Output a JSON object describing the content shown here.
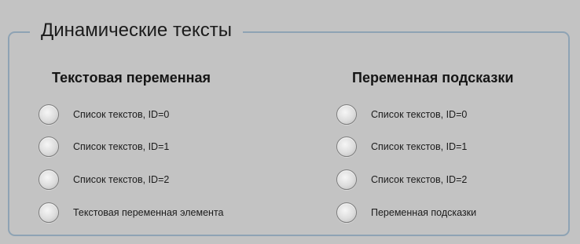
{
  "group": {
    "title": "Динамические тексты"
  },
  "left_column": {
    "header": "Текстовая переменная",
    "options": [
      {
        "label": "Список текстов, ID=0",
        "selected": false
      },
      {
        "label": "Список текстов, ID=1",
        "selected": false
      },
      {
        "label": "Список текстов, ID=2",
        "selected": false
      },
      {
        "label": "Текстовая переменная элемента",
        "selected": false
      }
    ]
  },
  "right_column": {
    "header": "Переменная подсказки",
    "options": [
      {
        "label": "Список текстов, ID=0",
        "selected": false
      },
      {
        "label": "Список текстов, ID=1",
        "selected": false
      },
      {
        "label": "Список текстов, ID=2",
        "selected": false
      },
      {
        "label": "Переменная подсказки",
        "selected": false
      }
    ]
  }
}
